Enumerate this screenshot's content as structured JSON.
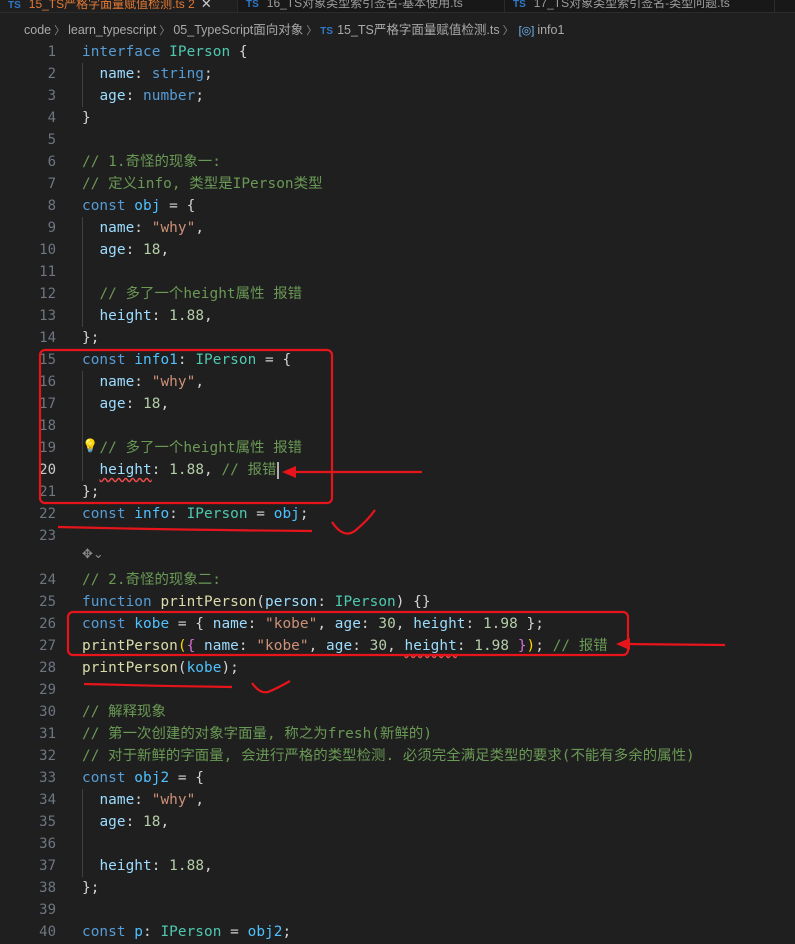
{
  "tabs": [
    {
      "label": "15_TS严格字面量赋值检测.ts",
      "badge": "2",
      "active": true
    },
    {
      "label": "16_TS对象类型索引签名-基本使用.ts",
      "active": false
    },
    {
      "label": "17_TS对象类型索引签名-类型问题.ts",
      "active": false
    }
  ],
  "breadcrumb": {
    "items": [
      "code",
      "learn_typescript",
      "05_TypeScript面向对象"
    ],
    "file_icon": "TS",
    "file": "15_TS严格字面量赋值检测.ts",
    "symbol": "info1"
  },
  "editor": {
    "current_line": 20,
    "lines": [
      {
        "n": "1",
        "tokens": [
          [
            "kw",
            "interface"
          ],
          [
            "pu",
            " "
          ],
          [
            "ty",
            "IPerson"
          ],
          [
            "pu",
            " {"
          ]
        ]
      },
      {
        "n": "2",
        "tokens": [
          [
            "pu",
            "  "
          ],
          [
            "pr",
            "name"
          ],
          [
            "pu",
            ": "
          ],
          [
            "kw",
            "string"
          ],
          [
            "pu",
            ";"
          ]
        ]
      },
      {
        "n": "3",
        "tokens": [
          [
            "pu",
            "  "
          ],
          [
            "pr",
            "age"
          ],
          [
            "pu",
            ": "
          ],
          [
            "kw",
            "number"
          ],
          [
            "pu",
            ";"
          ]
        ]
      },
      {
        "n": "4",
        "tokens": [
          [
            "pu",
            "}"
          ]
        ]
      },
      {
        "n": "5",
        "tokens": []
      },
      {
        "n": "6",
        "tokens": [
          [
            "cm",
            "// 1.奇怪的现象一:"
          ]
        ]
      },
      {
        "n": "7",
        "tokens": [
          [
            "cm",
            "// 定义info, 类型是IPerson类型"
          ]
        ]
      },
      {
        "n": "8",
        "tokens": [
          [
            "kw",
            "const"
          ],
          [
            "pu",
            " "
          ],
          [
            "va",
            "obj"
          ],
          [
            "pu",
            " = {"
          ]
        ]
      },
      {
        "n": "9",
        "tokens": [
          [
            "pu",
            "  "
          ],
          [
            "pr",
            "name"
          ],
          [
            "pu",
            ": "
          ],
          [
            "st",
            "\"why\""
          ],
          [
            "pu",
            ","
          ]
        ]
      },
      {
        "n": "10",
        "tokens": [
          [
            "pu",
            "  "
          ],
          [
            "pr",
            "age"
          ],
          [
            "pu",
            ": "
          ],
          [
            "nu",
            "18"
          ],
          [
            "pu",
            ","
          ]
        ]
      },
      {
        "n": "11",
        "tokens": []
      },
      {
        "n": "12",
        "tokens": [
          [
            "pu",
            "  "
          ],
          [
            "cm",
            "// 多了一个height属性 报错"
          ]
        ]
      },
      {
        "n": "13",
        "tokens": [
          [
            "pu",
            "  "
          ],
          [
            "pr",
            "height"
          ],
          [
            "pu",
            ": "
          ],
          [
            "nu",
            "1.88"
          ],
          [
            "pu",
            ","
          ]
        ]
      },
      {
        "n": "14",
        "tokens": [
          [
            "pu",
            "};"
          ]
        ]
      },
      {
        "n": "15",
        "tokens": [
          [
            "kw",
            "const"
          ],
          [
            "pu",
            " "
          ],
          [
            "va",
            "info1"
          ],
          [
            "pu",
            ": "
          ],
          [
            "ty",
            "IPerson"
          ],
          [
            "pu",
            " = {"
          ]
        ]
      },
      {
        "n": "16",
        "tokens": [
          [
            "pu",
            "  "
          ],
          [
            "pr",
            "name"
          ],
          [
            "pu",
            ": "
          ],
          [
            "st",
            "\"why\""
          ],
          [
            "pu",
            ","
          ]
        ]
      },
      {
        "n": "17",
        "tokens": [
          [
            "pu",
            "  "
          ],
          [
            "pr",
            "age"
          ],
          [
            "pu",
            ": "
          ],
          [
            "nu",
            "18"
          ],
          [
            "pu",
            ","
          ]
        ]
      },
      {
        "n": "18",
        "tokens": []
      },
      {
        "n": "19",
        "tokens": [
          [
            "pu",
            "  "
          ],
          [
            "cm",
            "// 多了一个height属性 报错"
          ]
        ]
      },
      {
        "n": "20",
        "tokens": [
          [
            "pu",
            "  "
          ],
          [
            "pr squig",
            "height"
          ],
          [
            "pu",
            ": "
          ],
          [
            "nu",
            "1.88"
          ],
          [
            "pu",
            ", "
          ],
          [
            "cm",
            "// 报错"
          ]
        ]
      },
      {
        "n": "21",
        "tokens": [
          [
            "pu",
            "};"
          ]
        ]
      },
      {
        "n": "22",
        "tokens": [
          [
            "kw",
            "const"
          ],
          [
            "pu",
            " "
          ],
          [
            "va",
            "info"
          ],
          [
            "pu",
            ": "
          ],
          [
            "ty",
            "IPerson"
          ],
          [
            "pu",
            " = "
          ],
          [
            "va",
            "obj"
          ],
          [
            "pu",
            ";"
          ]
        ]
      },
      {
        "n": "23",
        "tokens": []
      },
      {
        "n": "24",
        "tokens": [
          [
            "cm",
            "// 2.奇怪的现象二:"
          ]
        ]
      },
      {
        "n": "25",
        "tokens": [
          [
            "kw",
            "function"
          ],
          [
            "pu",
            " "
          ],
          [
            "fn",
            "printPerson"
          ],
          [
            "pu",
            "("
          ],
          [
            "pr",
            "person"
          ],
          [
            "pu",
            ": "
          ],
          [
            "ty",
            "IPerson"
          ],
          [
            "pu",
            ") {}"
          ]
        ]
      },
      {
        "n": "26",
        "tokens": [
          [
            "kw",
            "const"
          ],
          [
            "pu",
            " "
          ],
          [
            "va",
            "kobe"
          ],
          [
            "pu",
            " = { "
          ],
          [
            "pr",
            "name"
          ],
          [
            "pu",
            ": "
          ],
          [
            "st",
            "\"kobe\""
          ],
          [
            "pu",
            ", "
          ],
          [
            "pr",
            "age"
          ],
          [
            "pu",
            ": "
          ],
          [
            "nu",
            "30"
          ],
          [
            "pu",
            ", "
          ],
          [
            "pr",
            "height"
          ],
          [
            "pu",
            ": "
          ],
          [
            "nu",
            "1.98"
          ],
          [
            "pu",
            " };"
          ]
        ]
      },
      {
        "n": "27",
        "tokens": [
          [
            "fn",
            "printPerson"
          ],
          [
            "br1",
            "("
          ],
          [
            "br2",
            "{"
          ],
          [
            "pu",
            " "
          ],
          [
            "pr",
            "name"
          ],
          [
            "pu",
            ": "
          ],
          [
            "st",
            "\"kobe\""
          ],
          [
            "pu",
            ", "
          ],
          [
            "pr",
            "age"
          ],
          [
            "pu",
            ": "
          ],
          [
            "nu",
            "30"
          ],
          [
            "pu",
            ", "
          ],
          [
            "pr squig",
            "height"
          ],
          [
            "pu",
            ": "
          ],
          [
            "nu",
            "1.98"
          ],
          [
            "pu",
            " "
          ],
          [
            "br2",
            "}"
          ],
          [
            "br1",
            ")"
          ],
          [
            "pu",
            "; "
          ],
          [
            "cm",
            "// 报错"
          ]
        ]
      },
      {
        "n": "28",
        "tokens": [
          [
            "fn",
            "printPerson"
          ],
          [
            "pu",
            "("
          ],
          [
            "va",
            "kobe"
          ],
          [
            "pu",
            ");"
          ]
        ]
      },
      {
        "n": "29",
        "tokens": []
      },
      {
        "n": "30",
        "tokens": [
          [
            "cm",
            "// 解释现象"
          ]
        ]
      },
      {
        "n": "31",
        "tokens": [
          [
            "cm",
            "// 第一次创建的对象字面量, 称之为fresh(新鲜的)"
          ]
        ]
      },
      {
        "n": "32",
        "tokens": [
          [
            "cm",
            "// 对于新鲜的字面量, 会进行严格的类型检测. 必须完全满足类型的要求(不能有多余的属性)"
          ]
        ]
      },
      {
        "n": "33",
        "tokens": [
          [
            "kw",
            "const"
          ],
          [
            "pu",
            " "
          ],
          [
            "va",
            "obj2"
          ],
          [
            "pu",
            " = {"
          ]
        ]
      },
      {
        "n": "34",
        "tokens": [
          [
            "pu",
            "  "
          ],
          [
            "pr",
            "name"
          ],
          [
            "pu",
            ": "
          ],
          [
            "st",
            "\"why\""
          ],
          [
            "pu",
            ","
          ]
        ]
      },
      {
        "n": "35",
        "tokens": [
          [
            "pu",
            "  "
          ],
          [
            "pr",
            "age"
          ],
          [
            "pu",
            ": "
          ],
          [
            "nu",
            "18"
          ],
          [
            "pu",
            ","
          ]
        ]
      },
      {
        "n": "36",
        "tokens": []
      },
      {
        "n": "37",
        "tokens": [
          [
            "pu",
            "  "
          ],
          [
            "pr",
            "height"
          ],
          [
            "pu",
            ": "
          ],
          [
            "nu",
            "1.88"
          ],
          [
            "pu",
            ","
          ]
        ]
      },
      {
        "n": "38",
        "tokens": [
          [
            "pu",
            "};"
          ]
        ]
      },
      {
        "n": "39",
        "tokens": []
      },
      {
        "n": "40",
        "tokens": [
          [
            "kw",
            "const"
          ],
          [
            "pu",
            " "
          ],
          [
            "va",
            "p"
          ],
          [
            "pu",
            ": "
          ],
          [
            "ty",
            "IPerson"
          ],
          [
            "pu",
            " = "
          ],
          [
            "va",
            "obj2"
          ],
          [
            "pu",
            ";"
          ]
        ]
      }
    ]
  },
  "inline_icons": {
    "lightbulb": "lightbulb-icon",
    "copilot": "copilot-sparkle-icon"
  },
  "colors": {
    "annotation": "#e8141b",
    "keyword": "#569cd6",
    "type": "#4ec9b0",
    "comment": "#6a9955",
    "error": "#f14c4c"
  }
}
